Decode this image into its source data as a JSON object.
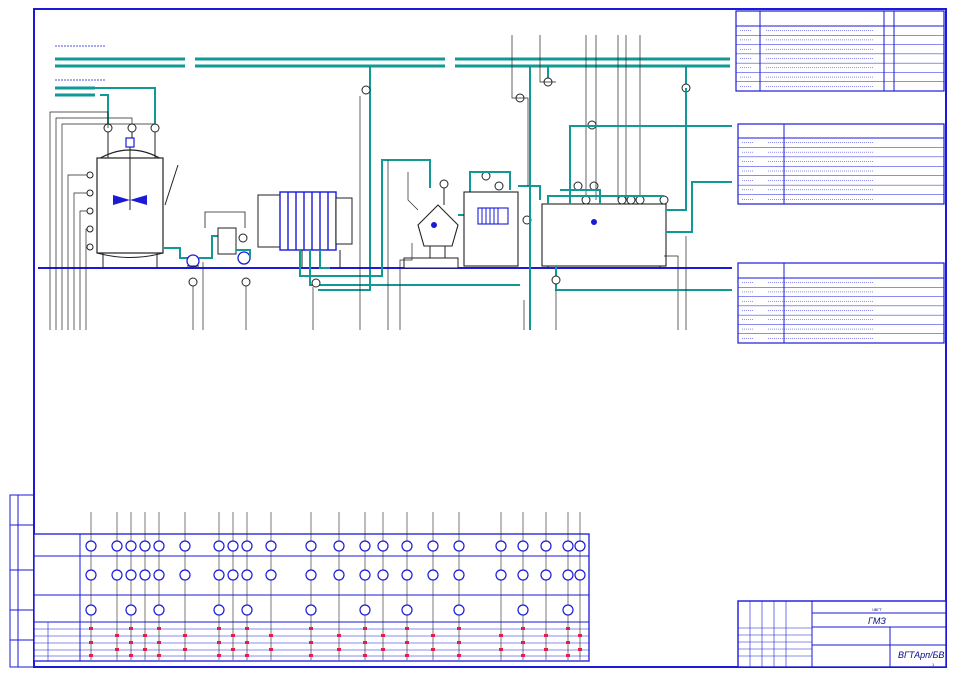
{
  "stamp": {
    "sheet_code": "ГМЗ",
    "doc_code": "ВГТАрп/БВ",
    "sheet_no": "1",
    "top_code": "ЧВГТ"
  },
  "colors": {
    "frame": "#1a1ad8",
    "pipe": "#119a95",
    "lines": "#222222",
    "marks": "#e0204a"
  },
  "legend_tables": [
    {
      "name": "legend-table-top",
      "rows": 7
    },
    {
      "name": "legend-table-middle",
      "rows": 7
    },
    {
      "name": "legend-table-bottom",
      "rows": 7
    }
  ],
  "equipment": [
    {
      "name": "tank-with-agitator",
      "icon": "mixer-tank-icon"
    },
    {
      "name": "pump",
      "icon": "pump-icon"
    },
    {
      "name": "balance-tank",
      "icon": "small-tank-icon"
    },
    {
      "name": "plate-heat-exchanger",
      "icon": "plate-exchanger-icon"
    },
    {
      "name": "separator",
      "icon": "separator-icon"
    },
    {
      "name": "homogenizer",
      "icon": "homogenizer-icon"
    },
    {
      "name": "storage-tank",
      "icon": "storage-tank-icon"
    }
  ]
}
